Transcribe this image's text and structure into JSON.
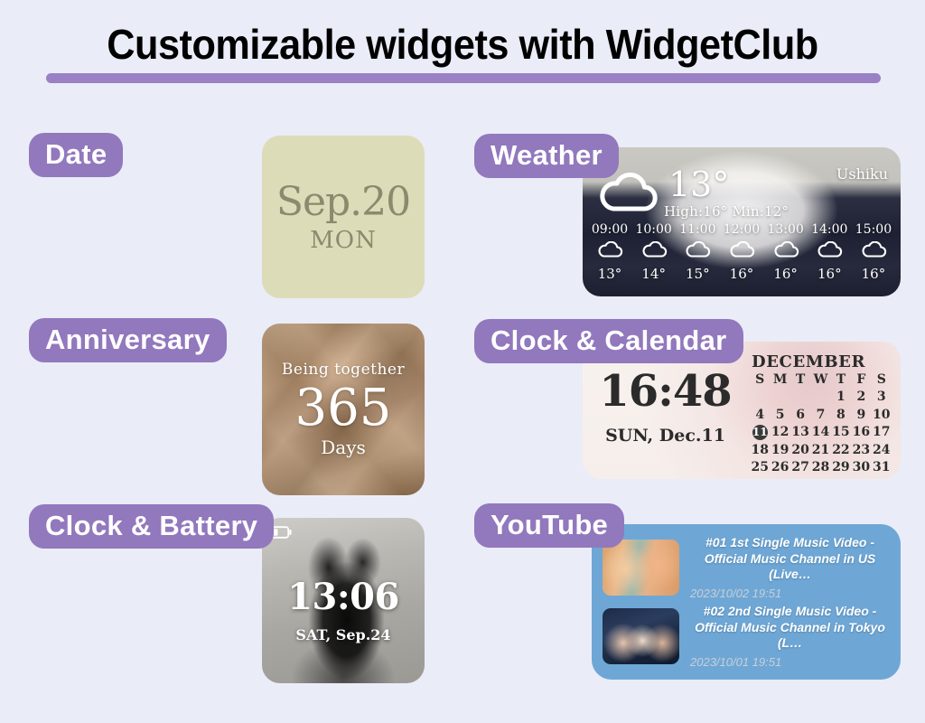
{
  "header": {
    "title": "Customizable widgets with WidgetClub",
    "accent_color": "#9278bd",
    "rule_color": "#9a80c4",
    "background_color": "#eaecf8"
  },
  "labels": {
    "date": "Date",
    "weather": "Weather",
    "anniversary": "Anniversary",
    "clock_calendar": "Clock & Calendar",
    "clock_battery": "Clock & Battery",
    "youtube": "YouTube"
  },
  "widgets": {
    "date": {
      "date_text": "Sep.20",
      "weekday": "MON",
      "background_color": "#dcdcb8",
      "text_color": "#8b8a6e"
    },
    "weather": {
      "location": "Ushiku",
      "current_temp": "13°",
      "high_low": "High:16° Min:12°",
      "condition_icon": "cloud-icon",
      "hourly": [
        {
          "time": "09:00",
          "icon": "cloud-icon",
          "temp": "13°"
        },
        {
          "time": "10:00",
          "icon": "cloud-icon",
          "temp": "14°"
        },
        {
          "time": "11:00",
          "icon": "cloud-icon",
          "temp": "15°"
        },
        {
          "time": "12:00",
          "icon": "cloud-icon",
          "temp": "16°"
        },
        {
          "time": "13:00",
          "icon": "cloud-icon",
          "temp": "16°"
        },
        {
          "time": "14:00",
          "icon": "cloud-icon",
          "temp": "16°"
        },
        {
          "time": "15:00",
          "icon": "cloud-icon",
          "temp": "16°"
        }
      ]
    },
    "anniversary": {
      "caption": "Being together",
      "count": "365",
      "unit": "Days"
    },
    "clock_calendar": {
      "time": "16:48",
      "date": "SUN, Dec.11",
      "month": "DECEMBER",
      "weekday_headers": [
        "S",
        "M",
        "T",
        "W",
        "T",
        "F",
        "S"
      ],
      "weeks": [
        [
          "",
          "",
          "",
          "",
          "1",
          "2",
          "3"
        ],
        [
          "4",
          "5",
          "6",
          "7",
          "8",
          "9",
          "10"
        ],
        [
          "11",
          "12",
          "13",
          "14",
          "15",
          "16",
          "17"
        ],
        [
          "18",
          "19",
          "20",
          "21",
          "22",
          "23",
          "24"
        ],
        [
          "25",
          "26",
          "27",
          "28",
          "29",
          "30",
          "31"
        ]
      ],
      "highlighted_day": "11"
    },
    "clock_battery": {
      "time": "13:06",
      "date": "SAT, Sep.24",
      "battery_icon": "battery-low-icon"
    },
    "youtube": {
      "background_color": "#6ea7d6",
      "videos": [
        {
          "title": "#01 1st Single Music Video - Official Music Channel in US (Live…",
          "published": "2023/10/02 19:51"
        },
        {
          "title": "#02 2nd Single Music Video - Official Music Channel in Tokyo (L…",
          "published": "2023/10/01 19:51"
        }
      ]
    }
  }
}
